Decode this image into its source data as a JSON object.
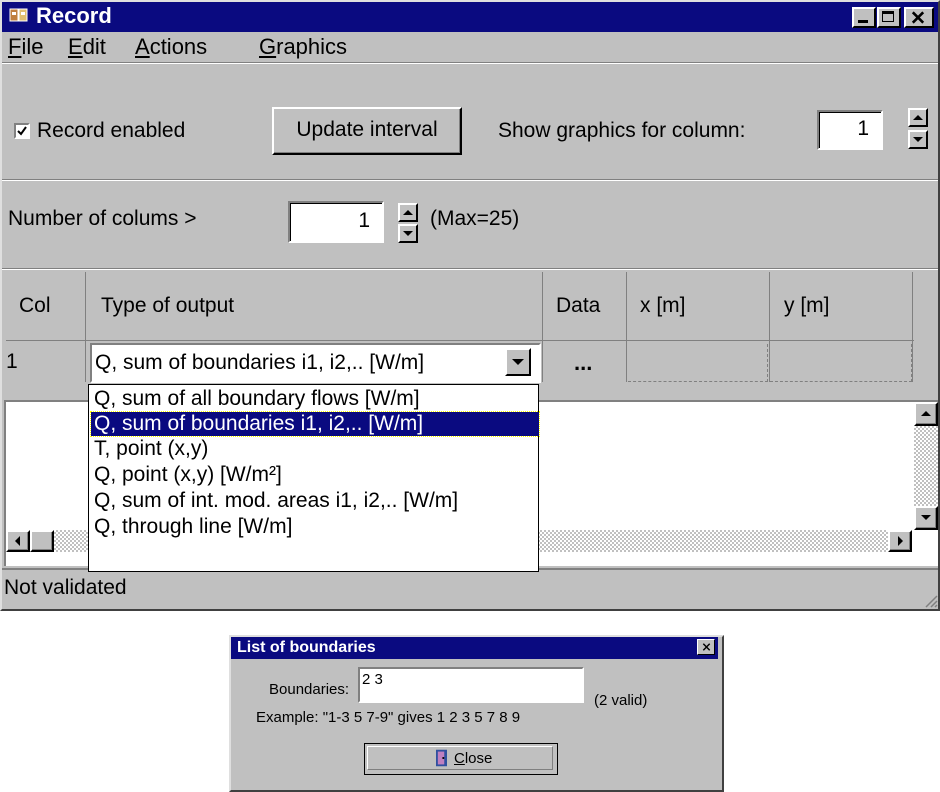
{
  "window": {
    "title": "Record",
    "menu": [
      {
        "accel": "F",
        "rest": "ile"
      },
      {
        "accel": "E",
        "rest": "dit"
      },
      {
        "accel": "A",
        "rest": "ctions"
      },
      {
        "accel": "G",
        "rest": "raphics"
      }
    ]
  },
  "toolbar": {
    "record_enabled_label": "Record enabled",
    "record_enabled_checked": true,
    "update_interval_label": "Update interval",
    "show_graphics_label": "Show graphics for column:",
    "show_graphics_value": "1"
  },
  "columns_row": {
    "label": "Number of colums  >",
    "value": "1",
    "max_label": "(Max=25)"
  },
  "grid": {
    "headers": [
      "Col",
      "Type of output",
      "Data",
      "x [m]",
      "y [m]"
    ],
    "row": {
      "col": "1",
      "type": "Q, sum of boundaries i1, i2,.. [W/m]",
      "data": "..."
    }
  },
  "dropdown": {
    "options": [
      "Q, sum of all boundary flows [W/m]",
      "Q, sum of boundaries i1, i2,.. [W/m]",
      "T, point (x,y)",
      "Q, point (x,y)  [W/m²]",
      "Q, sum of int. mod. areas i1, i2,.. [W/m]",
      "Q, through line  [W/m]"
    ],
    "selected_index": 1
  },
  "status": "Not validated",
  "dialog": {
    "title": "List of boundaries",
    "boundaries_label": "Boundaries:",
    "boundaries_value": "2 3",
    "valid_label": "(2 valid)",
    "example": "Example: \"1-3 5 7-9\" gives 1 2 3 5 7 8 9",
    "close_accel": "C",
    "close_rest": "lose"
  },
  "colors": {
    "title_bar": "#0a0a80",
    "face": "#c0c0c0",
    "selection": "#0a0a80"
  }
}
